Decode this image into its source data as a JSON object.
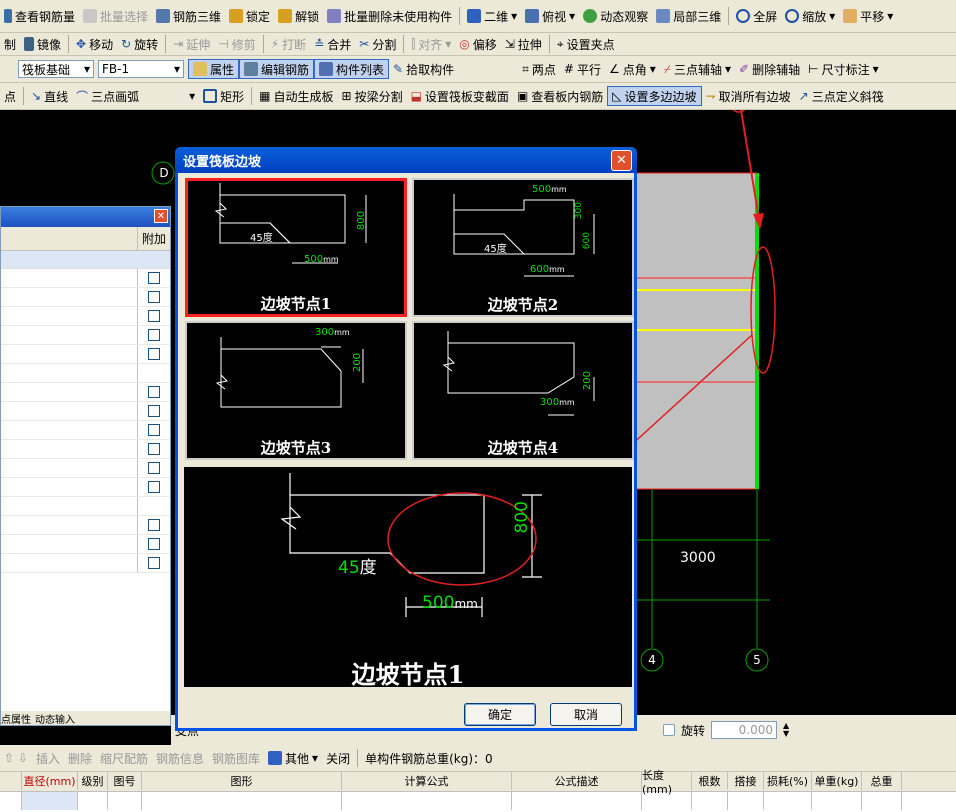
{
  "toolbar1": {
    "view_rebar": "查看钢筋量",
    "batch_select": "批量选择",
    "rebar_3d": "钢筋三维",
    "lock": "锁定",
    "unlock": "解锁",
    "batch_delete": "批量删除未使用构件",
    "view_2d": "二维",
    "top_view": "俯视",
    "dynamic_view": "动态观察",
    "local_3d": "局部三维",
    "fullscreen": "全屏",
    "zoom": "缩放",
    "pan": "平移"
  },
  "toolbar2": {
    "copy": "制",
    "mirror": "镜像",
    "move": "移动",
    "rotate": "旋转",
    "extend": "延伸",
    "trim": "修剪",
    "break": "打断",
    "merge": "合并",
    "split": "分割",
    "align": "对齐",
    "offset": "偏移",
    "stretch": "拉伸",
    "set_grip": "设置夹点"
  },
  "toolbar3": {
    "category_value": "筏板基础",
    "component_value": "FB-1",
    "properties": "属性",
    "edit_rebar": "编辑钢筋",
    "component_list": "构件列表",
    "pick_component": "拾取构件",
    "two_points": "两点",
    "parallel": "平行",
    "point_angle": "点角",
    "three_point_aux": "三点辅轴",
    "delete_aux": "删除辅轴",
    "dimension": "尺寸标注"
  },
  "toolbar4": {
    "point": "点",
    "line": "直线",
    "arc3": "三点画弧",
    "rect": "矩形",
    "auto_gen": "自动生成板",
    "split_by_beam": "按梁分割",
    "set_section": "设置筏板变截面",
    "view_inner_rebar": "查看板内钢筋",
    "set_multi_slope": "设置多边边坡",
    "cancel_all_slope": "取消所有边坡",
    "three_point_slope": "三点定义斜筏"
  },
  "canvas": {
    "axis_d": "D",
    "axis_4": "4",
    "axis_5": "5",
    "dimension_3000": "3000"
  },
  "left_panel": {
    "col_extra": "附加"
  },
  "dialog": {
    "title": "设置筏板边坡",
    "close": "✕",
    "cards": [
      {
        "label": "边坡节点1",
        "angle": "45度",
        "width": "500",
        "height": "800"
      },
      {
        "label": "边坡节点2",
        "angle": "45度",
        "top": "500",
        "h1": "300",
        "h2": "600",
        "width": "600"
      },
      {
        "label": "边坡节点3",
        "top": "300",
        "height": "200"
      },
      {
        "label": "边坡节点4",
        "bottom": "300",
        "height": "200"
      }
    ],
    "unit": "mm",
    "preview": {
      "label": "边坡节点1",
      "angle": "45",
      "angle_unit": "度",
      "width": "500",
      "height": "800"
    },
    "ok": "确定",
    "cancel": "取消"
  },
  "bottom": {
    "insert": "插入",
    "delete": "删除",
    "scale_rebar": "缩尺配筋",
    "rebar_info": "钢筋信息",
    "rebar_lib": "钢筋图库",
    "other": "其他",
    "close": "关闭",
    "total_weight": "单构件钢筋总重(kg)：0",
    "rotate": "旋转",
    "rotate_value": "0.000",
    "left_tab1": "点属性",
    "left_tab2": "动态输入",
    "support": "支点"
  },
  "table_headers": [
    "直径(mm)",
    "级别",
    "图号",
    "图形",
    "计算公式",
    "公式描述",
    "长度(mm)",
    "根数",
    "搭接",
    "损耗(%)",
    "单重(kg)",
    "总重"
  ],
  "colors": {
    "accent_red": "#e02020",
    "green": "#00c000",
    "toolbar": "#ece9d8",
    "title_blue": "#0054e3"
  }
}
